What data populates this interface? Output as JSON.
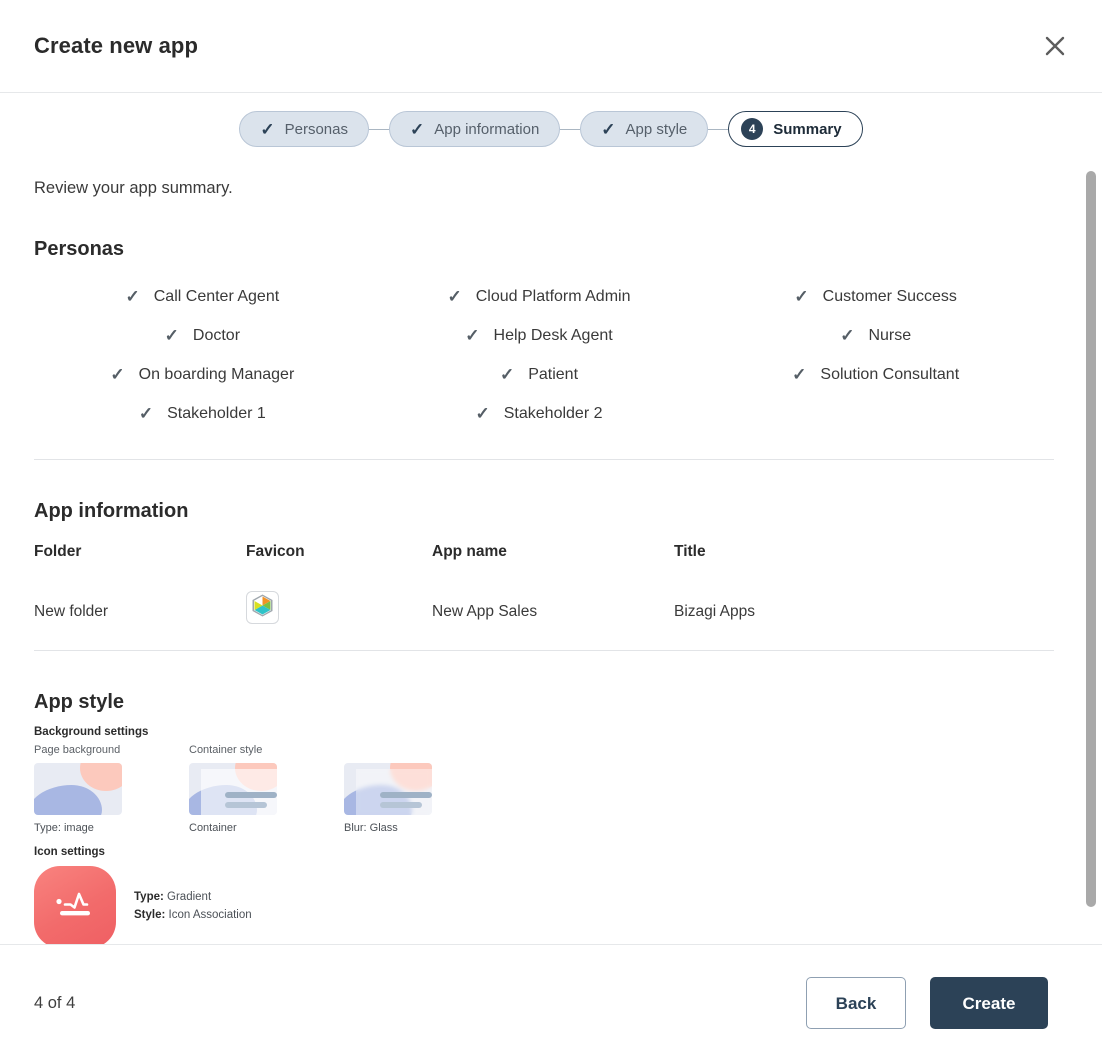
{
  "header": {
    "title": "Create new app",
    "close_label": "×"
  },
  "stepper": {
    "steps": [
      {
        "label": "Personas",
        "state": "done",
        "marker": "check"
      },
      {
        "label": "App information",
        "state": "done",
        "marker": "check"
      },
      {
        "label": "App style",
        "state": "done",
        "marker": "check"
      },
      {
        "label": "Summary",
        "state": "active",
        "marker": "4"
      }
    ]
  },
  "main": {
    "intro": "Review your app summary.",
    "personas": {
      "title": "Personas",
      "items": [
        "Call Center Agent",
        "Cloud Platform Admin",
        "Customer Success",
        "Doctor",
        "Help Desk Agent",
        "Nurse",
        "On boarding Manager",
        "Patient",
        "Solution Consultant",
        "Stakeholder 1",
        "Stakeholder 2"
      ],
      "check_glyph": "✓"
    },
    "app_information": {
      "title": "App information",
      "columns": [
        "Folder",
        "Favicon",
        "App name",
        "Title"
      ],
      "values": {
        "folder": "New folder",
        "favicon": "bizagi-cube-icon",
        "app_name": "New App Sales",
        "app_title": "Bizagi Apps"
      }
    },
    "app_style": {
      "title": "App style",
      "background_settings_label": "Background settings",
      "page_background_label": "Page background",
      "container_style_label": "Container style",
      "page_background_caption": "Type: image",
      "container_caption": "Container",
      "blur_caption": "Blur: Glass",
      "icon_settings_label": "Icon settings",
      "icon_type_key": "Type:",
      "icon_type_value": "Gradient",
      "icon_style_key": "Style:",
      "icon_style_value": "Icon Association"
    }
  },
  "footer": {
    "page_count": "4 of 4",
    "back_label": "Back",
    "create_label": "Create"
  },
  "colors": {
    "accent_navy": "#2c4257",
    "step_done_bg": "#dbe3ec",
    "icon_gradient_from": "#f9837f",
    "icon_gradient_to": "#ef5f63",
    "scrollbar": "#a9a9a9"
  }
}
